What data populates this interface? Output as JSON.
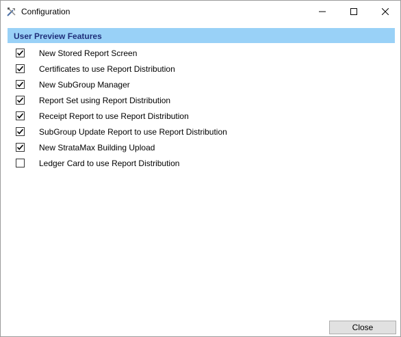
{
  "window": {
    "title": "Configuration",
    "icon": "tools-icon"
  },
  "section": {
    "title": "User Preview Features"
  },
  "features": [
    {
      "label": "New Stored Report Screen",
      "checked": true
    },
    {
      "label": "Certificates to use Report Distribution",
      "checked": true
    },
    {
      "label": "New SubGroup Manager",
      "checked": true
    },
    {
      "label": "Report Set using Report Distribution",
      "checked": true
    },
    {
      "label": "Receipt Report to use Report Distribution",
      "checked": true
    },
    {
      "label": "SubGroup Update Report to use Report Distribution",
      "checked": true
    },
    {
      "label": "New StrataMax Building Upload",
      "checked": true
    },
    {
      "label": "Ledger Card to use Report Distribution",
      "checked": false
    }
  ],
  "footer": {
    "close_label": "Close"
  },
  "colors": {
    "section_header_bg": "#99d1f7",
    "section_header_text": "#1f2f7a"
  }
}
